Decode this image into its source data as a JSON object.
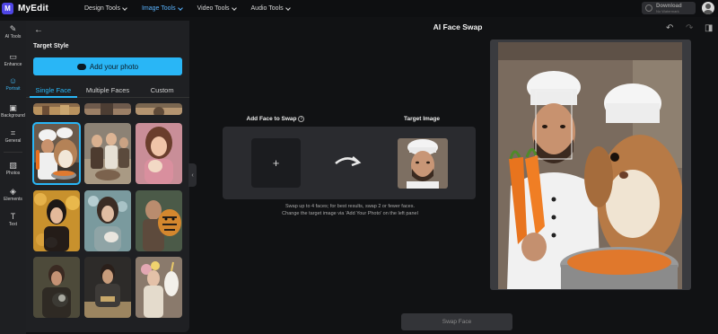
{
  "app": {
    "logo_letter": "M",
    "name": "MyEdit"
  },
  "topnav": [
    {
      "label": "Design Tools",
      "active": false
    },
    {
      "label": "Image Tools",
      "active": true
    },
    {
      "label": "Video Tools",
      "active": false
    },
    {
      "label": "Audio Tools",
      "active": false
    }
  ],
  "download": {
    "title": "Download",
    "subtitle": "No Watermark"
  },
  "rail": [
    {
      "label": "AI Tools",
      "icon": "magic-wand-icon",
      "active": false
    },
    {
      "label": "Enhance",
      "icon": "enhance-icon",
      "active": false
    },
    {
      "label": "Portrait",
      "icon": "portrait-icon",
      "active": true
    },
    {
      "label": "Background",
      "icon": "background-icon",
      "active": false
    },
    {
      "label": "General",
      "icon": "crop-icon",
      "active": false
    },
    {
      "label": "Photos",
      "icon": "photo-icon",
      "active": false
    },
    {
      "label": "Elements",
      "icon": "elements-icon",
      "active": false
    },
    {
      "label": "Text",
      "icon": "text-icon",
      "active": false
    }
  ],
  "panel": {
    "section_title": "Target Style",
    "add_photo_label": "Add your photo",
    "tabs": [
      {
        "label": "Single Face",
        "active": true
      },
      {
        "label": "Multiple Faces",
        "active": false
      },
      {
        "label": "Custom",
        "active": false
      }
    ]
  },
  "workspace": {
    "title": "AI Face Swap",
    "add_face_label": "Add Face to Swap",
    "target_label": "Target Image",
    "add_symbol": "+",
    "hint_line1": "Swap up to 4 faces; for best results, swap 2 or fewer faces.",
    "hint_line2": "Change the target image via 'Add Your Photo' on the left panel",
    "swap_button": "Swap Face"
  },
  "colors": {
    "accent": "#29b6f6",
    "brand": "#4f46e5",
    "panel_bg": "#1f2023",
    "app_bg": "#111214"
  }
}
